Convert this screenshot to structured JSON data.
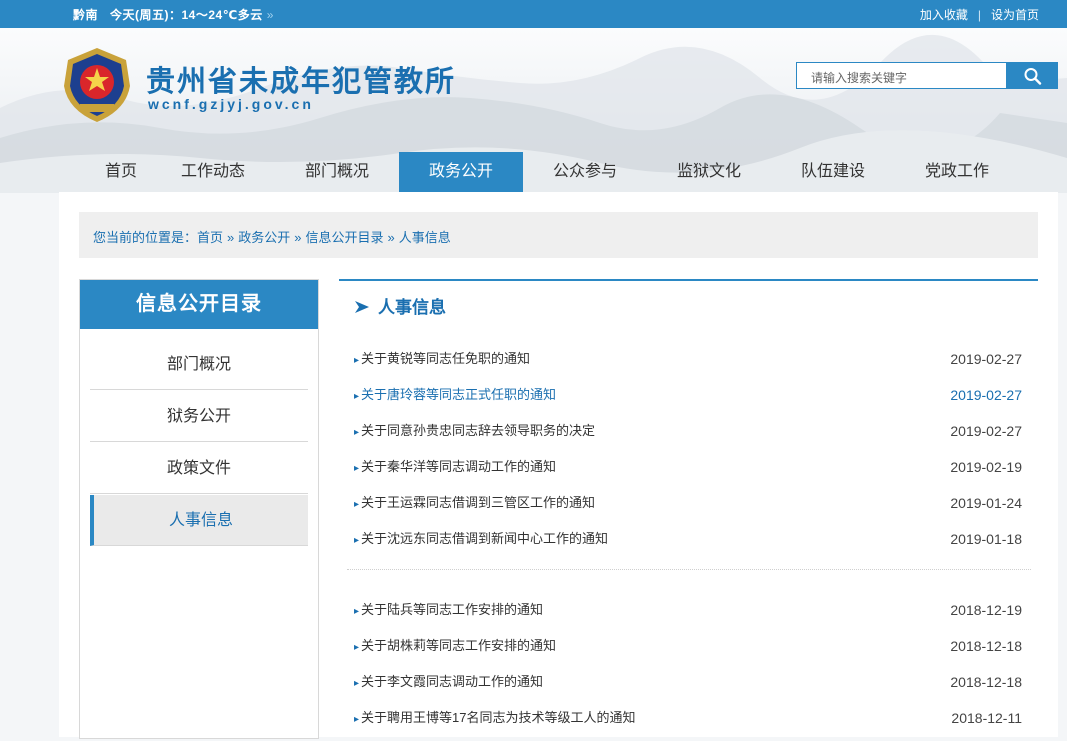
{
  "topbar": {
    "weather_city": "黔南",
    "weather_text": "今天(周五)：14～24℃多云",
    "arrow": "»",
    "add_favorite": "加入收藏",
    "separator": "|",
    "set_homepage": "设为首页"
  },
  "header": {
    "site_title": "贵州省未成年犯管教所",
    "site_url": "wcnf.gzjyj.gov.cn",
    "search_placeholder": "请输入搜索关键字"
  },
  "nav": {
    "items": [
      {
        "label": "首页"
      },
      {
        "label": "工作动态"
      },
      {
        "label": "部门概况"
      },
      {
        "label": "政务公开"
      },
      {
        "label": "公众参与"
      },
      {
        "label": "监狱文化"
      },
      {
        "label": "队伍建设"
      },
      {
        "label": "党政工作"
      }
    ],
    "active_index": 3
  },
  "breadcrumb": {
    "prefix": "您当前的位置是：",
    "sep": "»",
    "items": [
      "首页",
      "政务公开",
      "信息公开目录",
      "人事信息"
    ]
  },
  "sidebar": {
    "title": "信息公开目录",
    "items": [
      {
        "label": "部门概况"
      },
      {
        "label": "狱务公开"
      },
      {
        "label": "政策文件"
      },
      {
        "label": "人事信息"
      }
    ],
    "active_index": 3
  },
  "content": {
    "title": "人事信息",
    "group1": [
      {
        "title": "关于黄锐等同志任免职的通知",
        "date": "2019-02-27"
      },
      {
        "title": "关于唐玲蓉等同志正式任职的通知",
        "date": "2019-02-27"
      },
      {
        "title": "关于同意孙贵忠同志辞去领导职务的决定",
        "date": "2019-02-27"
      },
      {
        "title": "关于秦华洋等同志调动工作的通知",
        "date": "2019-02-19"
      },
      {
        "title": "关于王运霖同志借调到三管区工作的通知",
        "date": "2019-01-24"
      },
      {
        "title": "关于沈远东同志借调到新闻中心工作的通知",
        "date": "2019-01-18"
      }
    ],
    "group2": [
      {
        "title": "关于陆兵等同志工作安排的通知",
        "date": "2018-12-19"
      },
      {
        "title": "关于胡株莉等同志工作安排的通知",
        "date": "2018-12-18"
      },
      {
        "title": "关于李文霞同志调动工作的通知",
        "date": "2018-12-18"
      },
      {
        "title": "关于聘用王博等17名同志为技术等级工人的通知",
        "date": "2018-12-11"
      }
    ],
    "highlight_row": 1,
    "bullet": "▸"
  },
  "colors": {
    "primary": "#2b88c4",
    "link": "#1a6fb0"
  }
}
